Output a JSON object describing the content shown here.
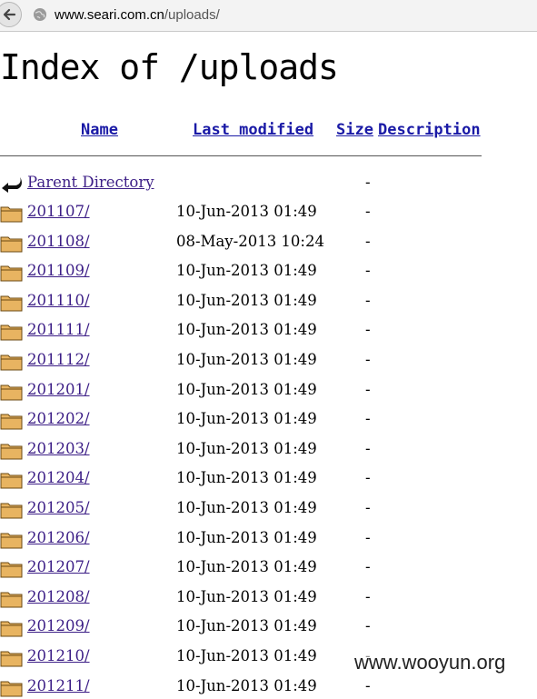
{
  "browser": {
    "url_host": "www.seari.com.cn",
    "url_path": "/uploads/"
  },
  "page": {
    "title": "Index of /uploads"
  },
  "headers": {
    "name": "Name",
    "last_modified": "Last modified",
    "size": "Size",
    "description": "Description"
  },
  "parent": {
    "label": "Parent Directory",
    "size": "-"
  },
  "rows": [
    {
      "name": "201107/",
      "modified": "10-Jun-2013 01:49",
      "size": "-"
    },
    {
      "name": "201108/",
      "modified": "08-May-2013 10:24",
      "size": "-"
    },
    {
      "name": "201109/",
      "modified": "10-Jun-2013 01:49",
      "size": "-"
    },
    {
      "name": "201110/",
      "modified": "10-Jun-2013 01:49",
      "size": "-"
    },
    {
      "name": "201111/",
      "modified": "10-Jun-2013 01:49",
      "size": "-"
    },
    {
      "name": "201112/",
      "modified": "10-Jun-2013 01:49",
      "size": "-"
    },
    {
      "name": "201201/",
      "modified": "10-Jun-2013 01:49",
      "size": "-"
    },
    {
      "name": "201202/",
      "modified": "10-Jun-2013 01:49",
      "size": "-"
    },
    {
      "name": "201203/",
      "modified": "10-Jun-2013 01:49",
      "size": "-"
    },
    {
      "name": "201204/",
      "modified": "10-Jun-2013 01:49",
      "size": "-"
    },
    {
      "name": "201205/",
      "modified": "10-Jun-2013 01:49",
      "size": "-"
    },
    {
      "name": "201206/",
      "modified": "10-Jun-2013 01:49",
      "size": "-"
    },
    {
      "name": "201207/",
      "modified": "10-Jun-2013 01:49",
      "size": "-"
    },
    {
      "name": "201208/",
      "modified": "10-Jun-2013 01:49",
      "size": "-"
    },
    {
      "name": "201209/",
      "modified": "10-Jun-2013 01:49",
      "size": "-"
    },
    {
      "name": "201210/",
      "modified": "10-Jun-2013 01:49",
      "size": "-"
    },
    {
      "name": "201211/",
      "modified": "10-Jun-2013 01:49",
      "size": "-"
    }
  ],
  "icons": {
    "back": "back-arrow-icon",
    "site": "globe-icon",
    "parent": "parent-directory-icon",
    "folder": "folder-icon"
  },
  "watermark": "www.wooyun.org"
}
